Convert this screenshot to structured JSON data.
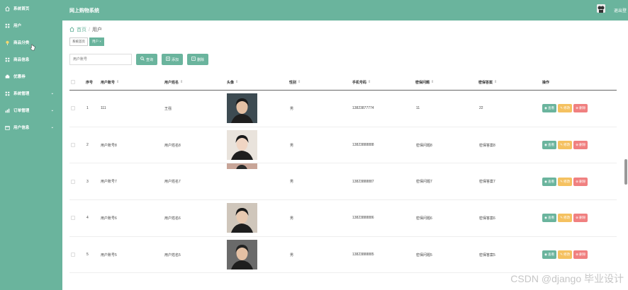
{
  "sidebar": {
    "items": [
      {
        "label": "系统首页",
        "icon": "home-icon",
        "arrow": ""
      },
      {
        "label": "用户",
        "icon": "grid-icon",
        "arrow": ""
      },
      {
        "label": "商品分类",
        "icon": "pin-icon",
        "arrow": ""
      },
      {
        "label": "商品信息",
        "icon": "grid-icon",
        "arrow": ""
      },
      {
        "label": "优惠券",
        "icon": "ticket-icon",
        "arrow": ""
      },
      {
        "label": "系统管理",
        "icon": "grid-icon",
        "arrow": "⌄"
      },
      {
        "label": "订单管理",
        "icon": "chart-icon",
        "arrow": "⌄"
      },
      {
        "label": "用户信息",
        "icon": "calendar-icon",
        "arrow": "⌄"
      }
    ]
  },
  "header": {
    "title": "网上购物系统",
    "logout": "退出登"
  },
  "breadcrumb": {
    "home": "首页",
    "sep": "/",
    "current": "用户"
  },
  "tags": {
    "home": "系统首页",
    "current": "用户 ×"
  },
  "toolbar": {
    "search_placeholder": "用户账号",
    "search_label": "查询",
    "add_label": "添加",
    "delete_label": "删除"
  },
  "table": {
    "headers": {
      "index": "序号",
      "account": "用户账号",
      "name": "用户姓名",
      "avatar": "头像",
      "gender": "性别",
      "phone": "手机号码",
      "question": "密保问题",
      "answer": "密保答案",
      "actions": "操作"
    },
    "rows": [
      {
        "index": "1",
        "account": "111",
        "name": "王强",
        "gender": "男",
        "phone": "13823877774",
        "question": "11",
        "answer": "22",
        "photo": "visible"
      },
      {
        "index": "2",
        "account": "用户账号8",
        "name": "用户姓名8",
        "gender": "男",
        "phone": "13823888888",
        "question": "密保问题8",
        "answer": "密保答案8",
        "photo": "visible"
      },
      {
        "index": "3",
        "account": "用户账号7",
        "name": "用户姓名7",
        "gender": "男",
        "phone": "13823888887",
        "question": "密保问题7",
        "answer": "密保答案7",
        "photo": "partial"
      },
      {
        "index": "4",
        "account": "用户账号6",
        "name": "用户姓名6",
        "gender": "男",
        "phone": "13823888886",
        "question": "密保问题6",
        "answer": "密保答案6",
        "photo": "visible"
      },
      {
        "index": "5",
        "account": "用户账号5",
        "name": "用户姓名5",
        "gender": "男",
        "phone": "13823888885",
        "question": "密保问题5",
        "answer": "密保答案5",
        "photo": "visible"
      }
    ],
    "view_label": "查看",
    "edit_label": "修改",
    "delete_label": "删除"
  },
  "watermark": "CSDN @django 毕业设计",
  "colors": {
    "accent": "#6ab49d",
    "edit": "#f5c160",
    "delete": "#f08080"
  }
}
